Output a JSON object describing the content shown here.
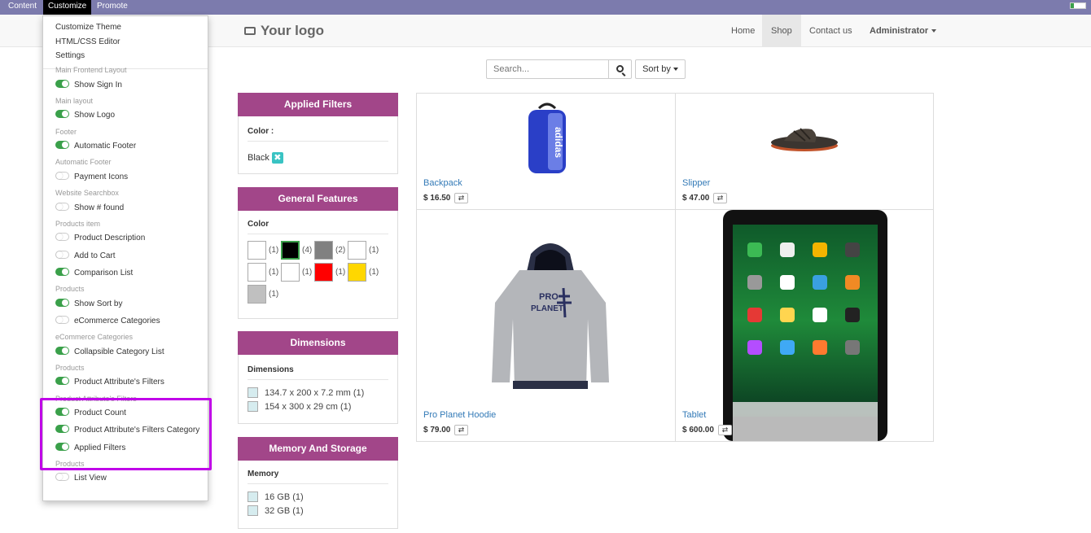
{
  "topbar": {
    "content": "Content",
    "customize": "Customize",
    "promote": "Promote"
  },
  "navbar": {
    "logo": "Your logo",
    "links": [
      "Home",
      "Shop",
      "Contact us",
      "Administrator"
    ]
  },
  "search": {
    "placeholder": "Search...",
    "sort_label": "Sort by"
  },
  "filters": {
    "applied": {
      "title": "Applied Filters",
      "color_label": "Color :",
      "value": "Black",
      "remove_icon": "close-icon"
    },
    "general": {
      "title": "General Features",
      "color_label": "Color",
      "swatches": [
        {
          "color": "#ffffff",
          "count": "(1)"
        },
        {
          "color": "#000000",
          "count": "(4)"
        },
        {
          "color": "#808080",
          "count": "(2)"
        },
        {
          "color": "#ffffff",
          "count": "(1)"
        },
        {
          "color": "#ffffff",
          "count": "(1)"
        },
        {
          "color": "#ffffff",
          "count": "(1)"
        },
        {
          "color": "#ff0000",
          "count": "(1)"
        },
        {
          "color": "#ffd700",
          "count": "(1)"
        },
        {
          "color": "#c0c0c0",
          "count": "(1)"
        }
      ]
    },
    "dimensions": {
      "title": "Dimensions",
      "sub": "Dimensions",
      "items": [
        "134.7 x 200 x 7.2 mm (1)",
        "154 x 300 x 29 cm (1)"
      ]
    },
    "memory": {
      "title": "Memory And Storage",
      "sub": "Memory",
      "items": [
        "16 GB (1)",
        "32 GB (1)"
      ]
    }
  },
  "products": [
    {
      "name": "Backpack",
      "price": "$ 16.50"
    },
    {
      "name": "Slipper",
      "price": "$ 47.00"
    },
    {
      "name": "Pro Planet Hoodie",
      "price": "$ 79.00"
    },
    {
      "name": "Tablet",
      "price": "$ 600.00"
    }
  ],
  "customize_menu": {
    "links": [
      "Customize Theme",
      "HTML/CSS Editor",
      "Settings"
    ],
    "options": [
      {
        "group": "Main Frontend Layout",
        "label": "Show Sign In",
        "on": true
      },
      {
        "group": "Main layout",
        "label": "Show Logo",
        "on": true
      },
      {
        "group": "Footer",
        "label": "Automatic Footer",
        "on": true
      },
      {
        "group": "Automatic Footer",
        "label": "Payment Icons",
        "on": false
      },
      {
        "group": "Website Searchbox",
        "label": "Show # found",
        "on": false
      },
      {
        "group": "Products item",
        "label": "Product Description",
        "on": false
      },
      {
        "group": "",
        "label": "Add to Cart",
        "on": false
      },
      {
        "group": "",
        "label": "Comparison List",
        "on": true
      },
      {
        "group": "Products",
        "label": "Show Sort by",
        "on": true
      },
      {
        "group": "",
        "label": "eCommerce Categories",
        "on": false
      },
      {
        "group": "eCommerce Categories",
        "label": "Collapsible Category List",
        "on": true
      },
      {
        "group": "Products",
        "label": "Product Attribute's Filters",
        "on": true
      },
      {
        "group": "Product Attribute's Filters",
        "label": "Product Count",
        "on": true
      },
      {
        "group": "",
        "label": "Product Attribute's Filters Category",
        "on": true
      },
      {
        "group": "",
        "label": "Applied Filters",
        "on": true
      },
      {
        "group": "Products",
        "label": "List View",
        "on": false
      }
    ]
  }
}
